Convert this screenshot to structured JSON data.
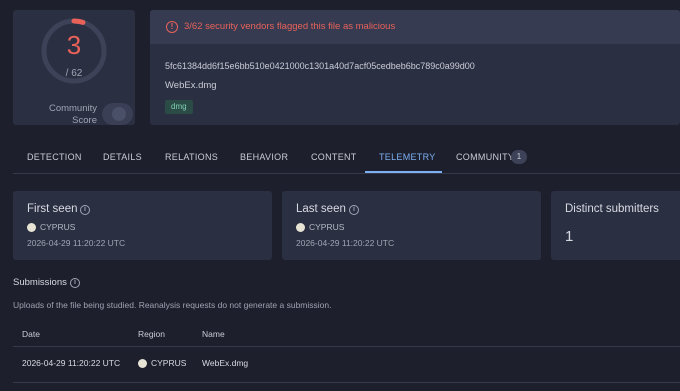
{
  "score": {
    "detections": "3",
    "total": "/ 62",
    "community_label": "Community Score",
    "ring_fraction": 0.0484,
    "ring_color": "#e86259"
  },
  "file": {
    "alert": "3/62 security vendors flagged this file as malicious",
    "hash": "5fc61384dd6f15e6bb510e0421000c1301a40d7acf05cedbeb6bc789c0a99d00",
    "name": "WebEx.dmg",
    "tag": "dmg"
  },
  "tabs": {
    "detection": "DETECTION",
    "details": "DETAILS",
    "relations": "RELATIONS",
    "behavior": "BEHAVIOR",
    "content": "CONTENT",
    "telemetry": "TELEMETRY",
    "community": "COMMUNITY",
    "community_count": "1",
    "active": "telemetry"
  },
  "telemetry": {
    "first_seen": {
      "title": "First seen",
      "country": "CYPRUS",
      "date": "2026-04-29 11:20:22 UTC"
    },
    "last_seen": {
      "title": "Last seen",
      "country": "CYPRUS",
      "date": "2026-04-29 11:20:22 UTC"
    },
    "distinct": {
      "title": "Distinct submitters",
      "value": "1"
    }
  },
  "submissions": {
    "title": "Submissions",
    "description": "Uploads of the file being studied. Reanalysis requests do not generate a submission.",
    "columns": [
      "Date",
      "Region",
      "Name"
    ],
    "rows": [
      {
        "date": "2026-04-29 11:20:22 UTC",
        "region": "CYPRUS",
        "name": "WebEx.dmg"
      }
    ]
  },
  "colors": {
    "accent": "#7cb0f2",
    "danger": "#e86259",
    "card": "#2b2f42",
    "background": "#1e1f2c"
  }
}
